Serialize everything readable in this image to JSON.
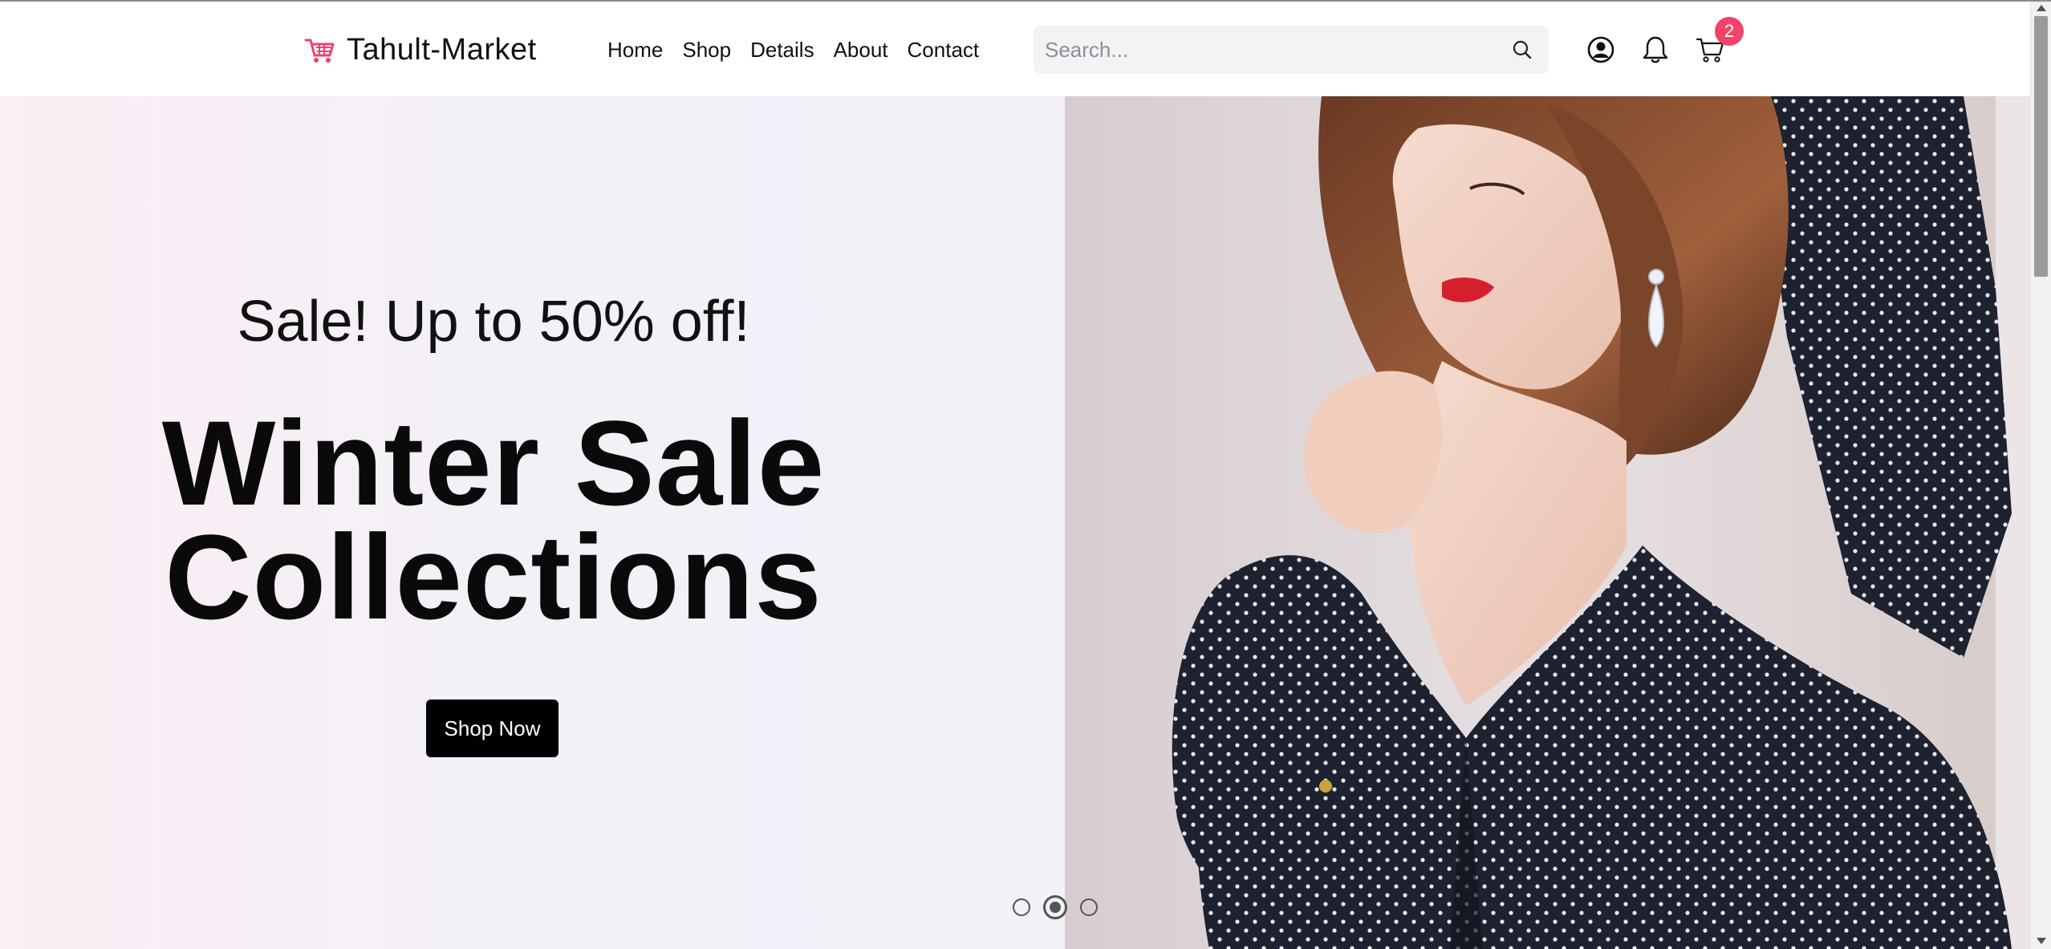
{
  "brand": {
    "name": "Tahult-Market",
    "logo_icon": "shopping-cart-icon",
    "logo_color": "#f0426a"
  },
  "nav": {
    "items": [
      {
        "label": "Home"
      },
      {
        "label": "Shop"
      },
      {
        "label": "Details"
      },
      {
        "label": "About"
      },
      {
        "label": "Contact"
      }
    ]
  },
  "search": {
    "placeholder": "Search...",
    "value": "",
    "icon": "search-icon"
  },
  "header_icons": {
    "user": "user-circle-icon",
    "notifications": "bell-icon",
    "cart": "cart-icon",
    "cart_count": "2",
    "badge_color": "#f0426a"
  },
  "hero": {
    "sale_text": "Sale! Up to 50% off!",
    "title_line1": "Winter Sale",
    "title_line2": "Collections",
    "cta_label": "Shop Now",
    "image_alt": "woman in polka dot blouse",
    "slides": {
      "total": 3,
      "active": 2
    }
  }
}
